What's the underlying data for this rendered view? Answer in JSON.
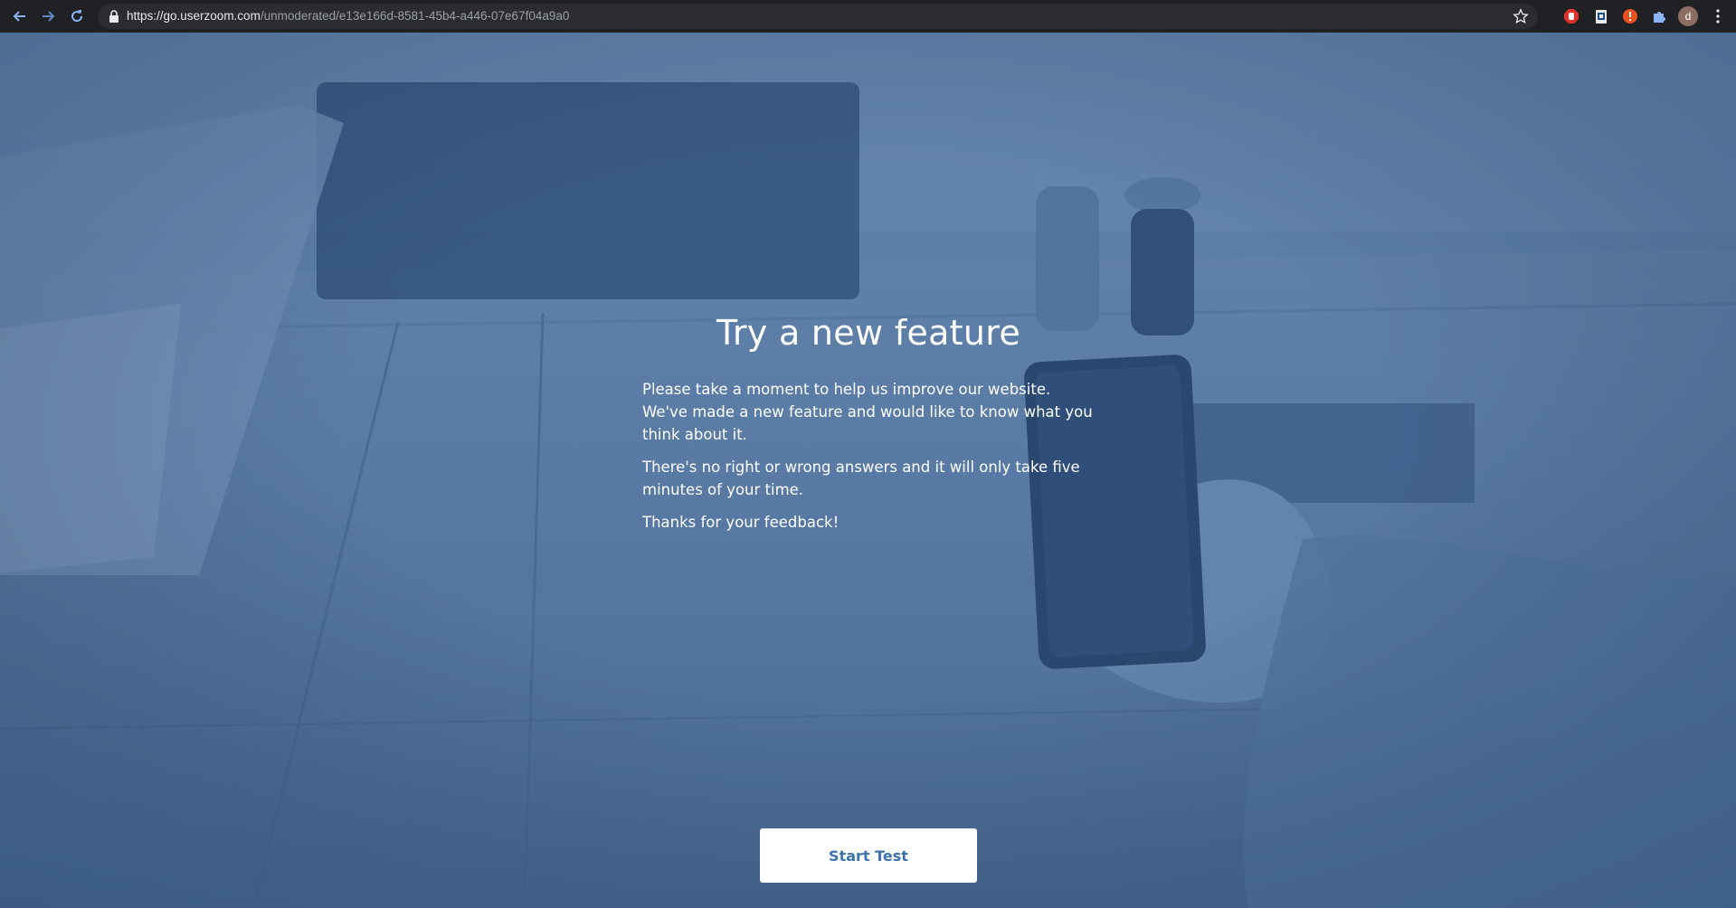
{
  "browser": {
    "url_host": "https://go.userzoom.com",
    "url_path": "/unmoderated/e13e166d-8581-45b4-a446-07e67f04a9a0",
    "profile_initial": "d"
  },
  "main": {
    "title": "Try a new feature",
    "paragraphs": [
      "Please take a moment to help us improve our website. We've made a new feature and would like to know what you think about it.",
      "There's no right or wrong answers and it will only take five minutes of your time.",
      "Thanks for your feedback!"
    ],
    "start_button": "Start Test"
  },
  "colors": {
    "overlay": "#5a7aa0",
    "button_text": "#3a73ad",
    "toolbar": "#202124"
  },
  "icons": [
    "back-icon",
    "forward-icon",
    "reload-icon",
    "lock-icon",
    "star-icon",
    "adblock-icon",
    "clipboard-extension-icon",
    "alert-extension-icon",
    "puzzle-icon",
    "kebab-menu-icon"
  ]
}
